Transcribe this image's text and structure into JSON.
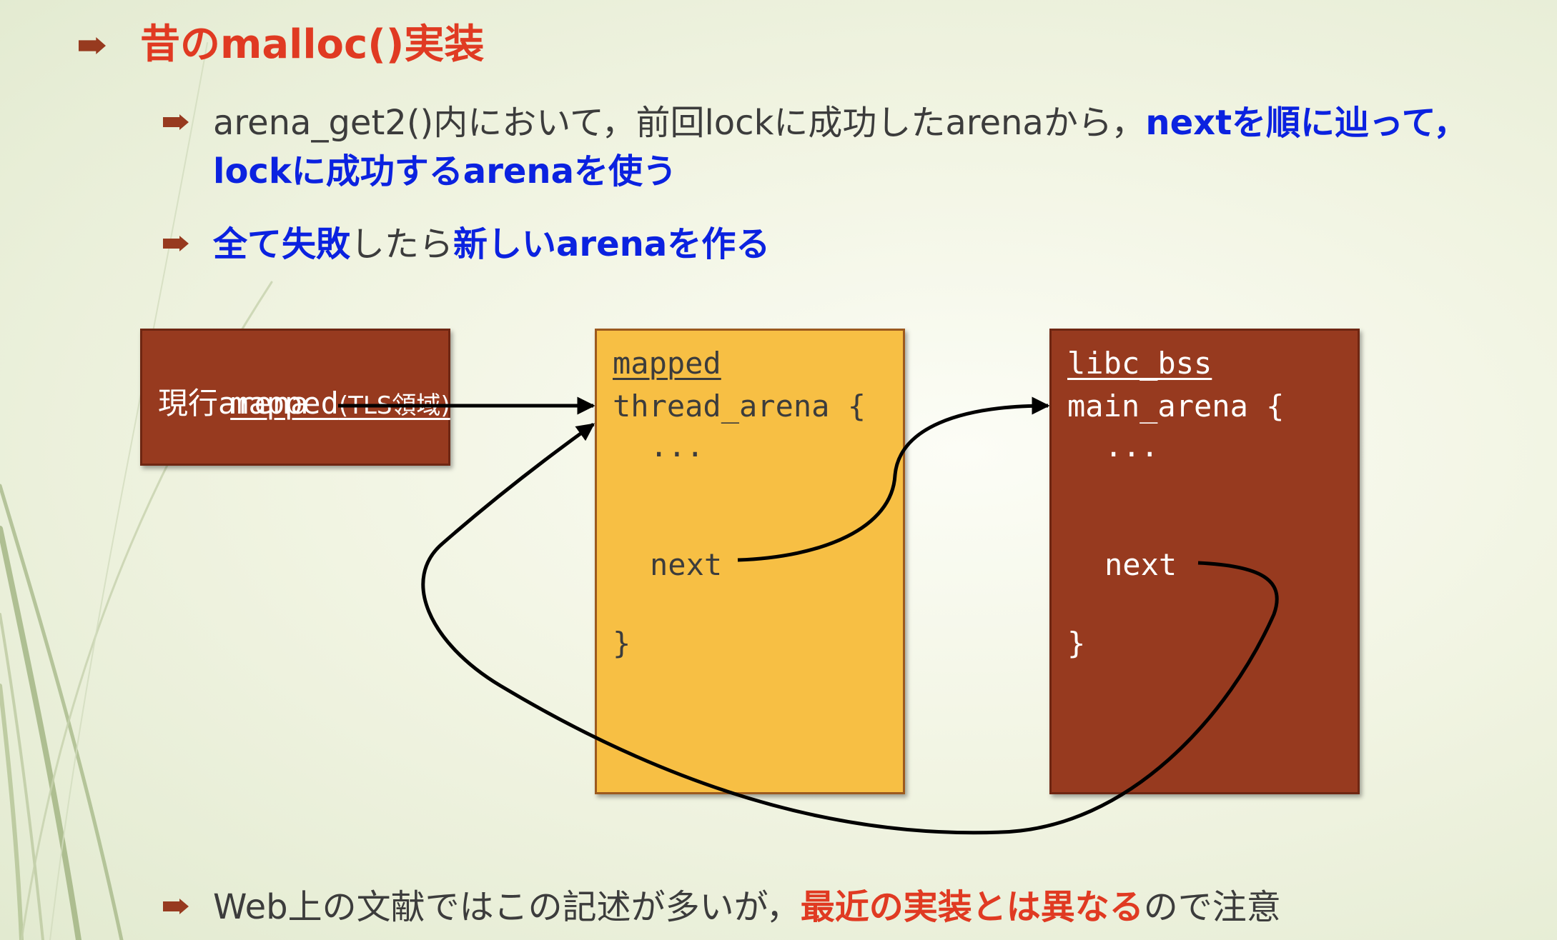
{
  "title": {
    "text": "昔のmalloc()実装"
  },
  "bullet1": {
    "part1": "arena_get2()内において，前回lockに成功したarenaから，",
    "part2": "nextを順に辿って，lockに成功するarenaを使う"
  },
  "bullet2": {
    "part1": "全て失敗",
    "part2": "したら",
    "part3": "新しいarenaを作る"
  },
  "bullet3": {
    "part1": "Web上の文献ではこの記述が多いが，",
    "part2": "最近の実装とは異なる",
    "part3": "ので注意"
  },
  "boxes": {
    "tls": {
      "heading": "mapped",
      "heading_note": "(TLS領域)",
      "field": "現行arena"
    },
    "thread": {
      "heading": "mapped",
      "struct_open": "thread_arena {",
      "ellipsis": "...",
      "field": "next",
      "struct_close": "}"
    },
    "main": {
      "heading": "libc_bss",
      "struct_open": "main_arena {",
      "ellipsis": "...",
      "field": "next",
      "struct_close": "}"
    }
  },
  "colors": {
    "brown": "#973a1f",
    "yellow": "#f7bf44",
    "red_emphasis": "#e03a22",
    "blue_emphasis": "#0b22e0"
  }
}
